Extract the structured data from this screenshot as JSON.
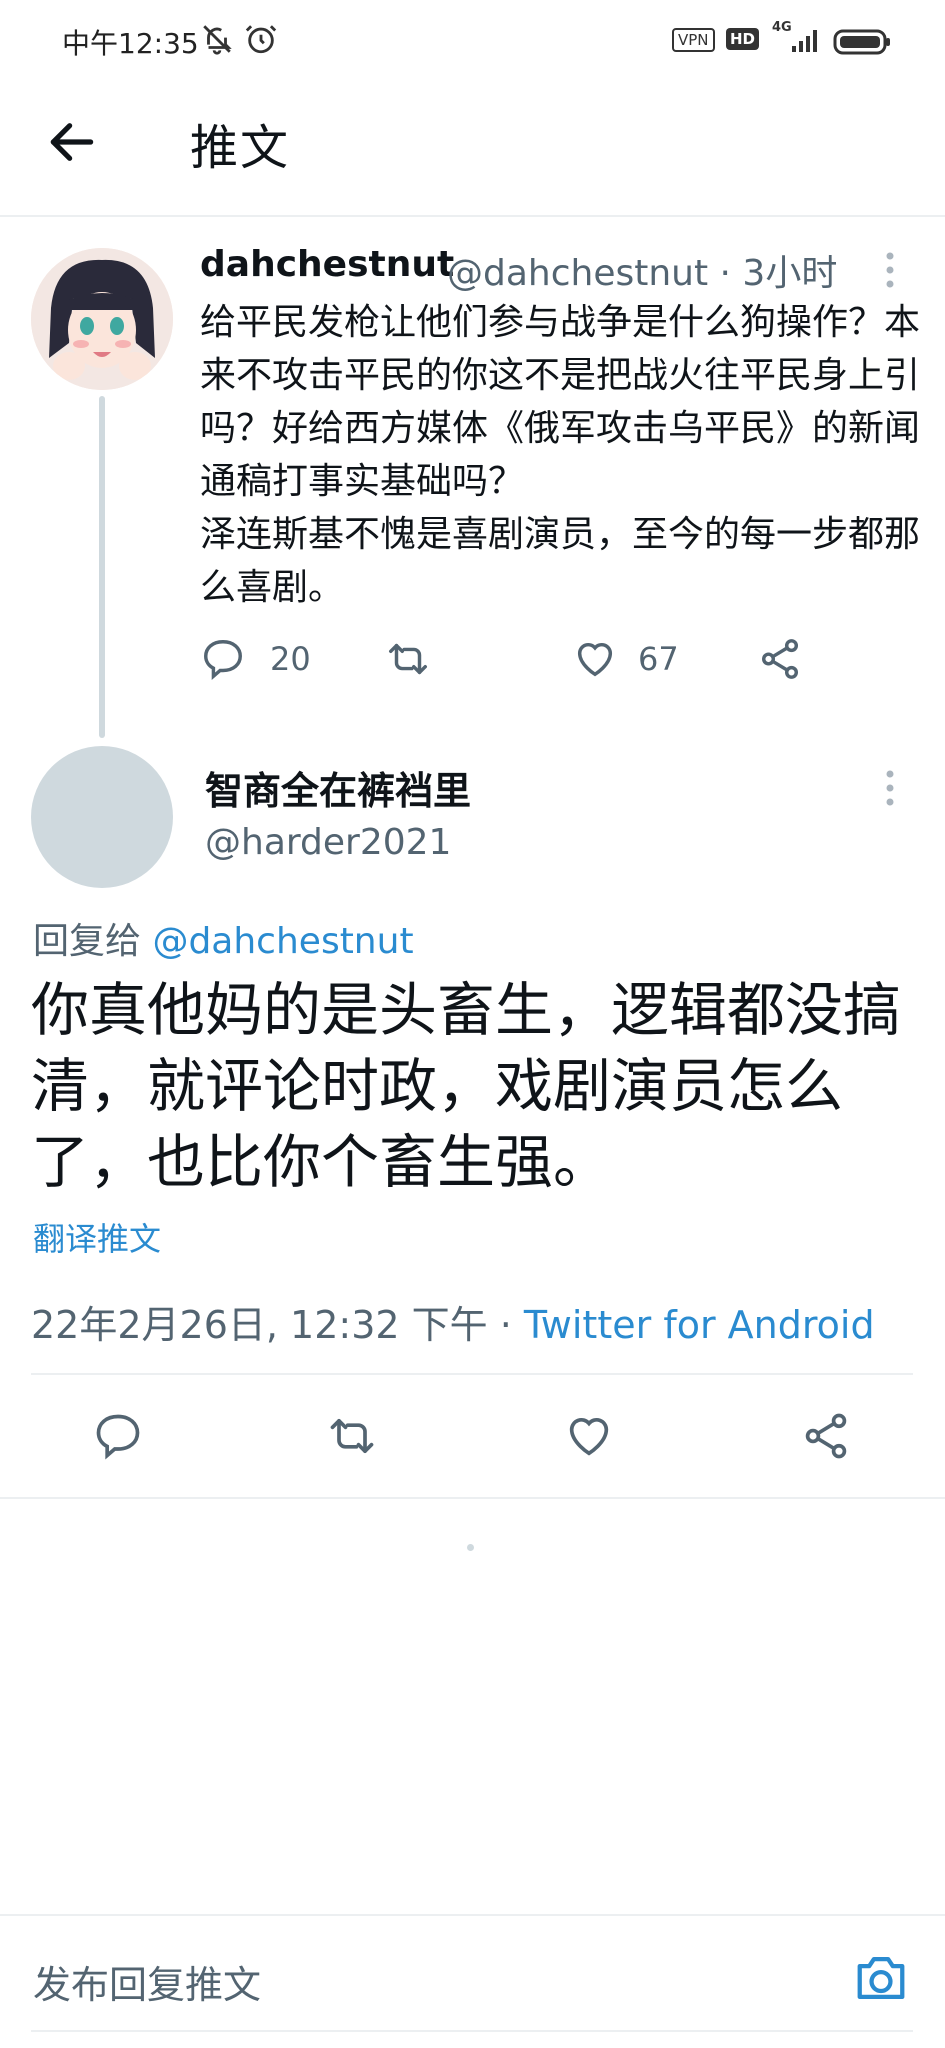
{
  "status_bar": {
    "time": "中午12:35",
    "vpn": "VPN",
    "hd": "HD",
    "network": "4G"
  },
  "header": {
    "title": "推文"
  },
  "parent_tweet": {
    "display_name": "dahchestnut",
    "handle_time": "@dahchestnut · 3小时",
    "text": "给平民发枪让他们参与战争是什么狗操作？本来不攻击平民的你这不是把战火往平民身上引吗？好给西方媒体《俄军攻击乌平民》的新闻通稿打事实基础吗？\n泽连斯基不愧是喜剧演员，至今的每一步都那么喜剧。",
    "reply_count": "20",
    "like_count": "67"
  },
  "main_tweet": {
    "display_name": "智商全在裤裆里",
    "handle": "@harder2021",
    "reply_prefix": "回复给 ",
    "reply_mention": "@dahchestnut",
    "text": "你真他妈的是头畜生，逻辑都没搞清，就评论时政，戏剧演员怎么了，也比你个畜生强。",
    "translate_label": "翻译推文",
    "timestamp": "22年2月26日, 12:32 下午 · ",
    "client": "Twitter for Android"
  },
  "composer": {
    "placeholder": "发布回复推文"
  },
  "icons": {
    "back": "arrow-left-icon",
    "more": "more-vertical-icon",
    "reply": "reply-icon",
    "retweet": "retweet-icon",
    "like": "heart-icon",
    "share": "share-icon",
    "camera": "camera-icon",
    "mute": "bell-off-icon",
    "alarm": "alarm-icon"
  },
  "colors": {
    "accent": "#2a8bd0",
    "secondary_text": "#536471",
    "divider": "#eceff1",
    "thread_line": "#cfd9de"
  }
}
